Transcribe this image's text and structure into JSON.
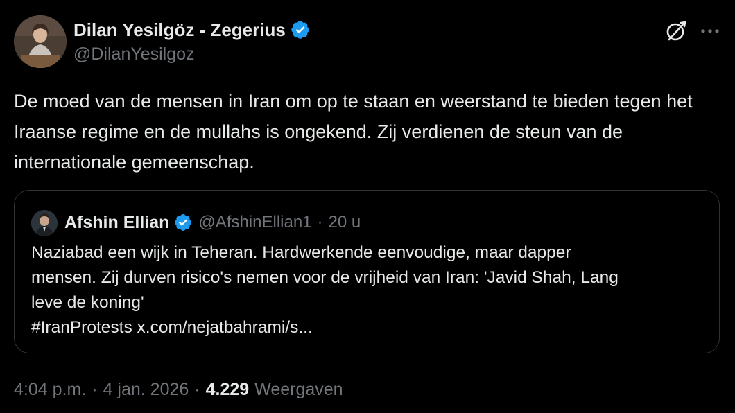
{
  "author": {
    "name": "Dilan Yesilgöz - Zegerius",
    "handle": "@DilanYesilgoz",
    "verified_color": "#1d9bf0"
  },
  "header_icons": {
    "grok": "grok-icon",
    "more": "more-icon"
  },
  "tweet": {
    "text": "De moed van de mensen in Iran om op te staan en weerstand te bieden tegen het Iraanse regime en de mullahs is ongekend. Zij verdienen de steun van de internationale gemeenschap."
  },
  "quote": {
    "name": "Afshin Ellian",
    "handle": "@AfshinEllian1",
    "separator": "·",
    "time": "20 u",
    "lines": [
      "Naziabad een wijk in Teheran. Hardwerkende eenvoudige, maar dapper",
      "mensen. Zij durven risico's nemen voor de vrijheid van Iran: 'Javid Shah, Lang",
      "leve de koning'",
      "#IranProtests x.com/nejatbahrami/s..."
    ]
  },
  "meta": {
    "time": "4:04 p.m.",
    "separator": "·",
    "date": "4 jan. 2026",
    "views_count": "4.229",
    "views_label": "Weergaven"
  },
  "colors": {
    "background": "#000000",
    "text_primary": "#e7e9ea",
    "text_secondary": "#71767b",
    "border": "#2f3336",
    "verified": "#1d9bf0"
  }
}
